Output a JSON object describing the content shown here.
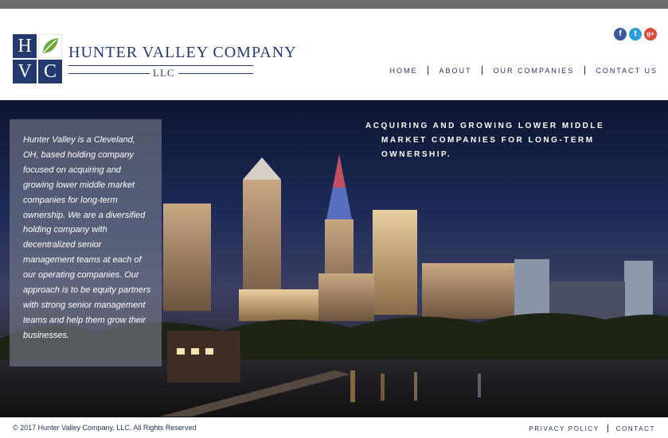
{
  "logo": {
    "letters": {
      "h": "H",
      "v": "V",
      "c": "C"
    },
    "name": "HUNTER VALLEY COMPANY",
    "suffix": "LLC",
    "leaf_icon": "leaf-icon"
  },
  "social": [
    {
      "icon": "facebook-icon",
      "glyph": "f"
    },
    {
      "icon": "twitter-icon",
      "glyph": "t"
    },
    {
      "icon": "google-plus-icon",
      "glyph": "g+"
    }
  ],
  "nav": {
    "home": "HOME",
    "about": "ABOUT",
    "companies": "OUR COMPANIES",
    "contact": "CONTACT US"
  },
  "hero": {
    "tagline_line1": "Acquiring and growing lower middle",
    "tagline_line2": "market companies for long-term ownership.",
    "about": "Hunter Valley is a Cleveland, OH, based holding company focused on acquiring and growing lower middle market companies for long-term ownership. We are a diversified holding company with decentralized senior management teams at each of our operating companies. Our approach is to be equity partners with strong senior management teams and help them grow their businesses."
  },
  "footer": {
    "copyright": "© 2017   Hunter Valley Company, LLC. All Rights Reserved",
    "privacy": "PRIVACY POLICY",
    "contact": "CONTACT"
  },
  "colors": {
    "brand_navy": "#243a6e",
    "top_bar": "#6d6d6d",
    "leaf_green": "#6fa83a"
  }
}
